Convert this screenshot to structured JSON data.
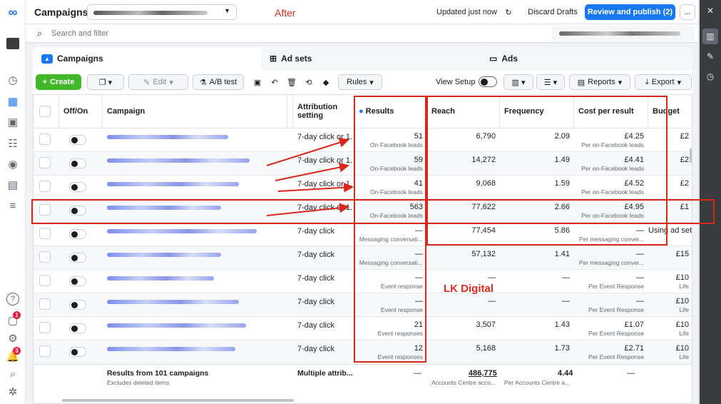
{
  "header": {
    "title": "Campaigns",
    "annotation": "After",
    "status": "Updated just now",
    "discard": "Discard Drafts",
    "review": "Review and publish (2)",
    "more": "..."
  },
  "search": {
    "placeholder": "Search and filter"
  },
  "tabs": [
    {
      "label": "Campaigns"
    },
    {
      "label": "Ad sets"
    },
    {
      "label": "Ads"
    }
  ],
  "toolbar": {
    "create": "Create",
    "edit": "Edit",
    "abtest": "A/B test",
    "rules": "Rules",
    "view_setup": "View Setup",
    "reports": "Reports",
    "export": "Export"
  },
  "columns": {
    "onoff": "Off/On",
    "campaign": "Campaign",
    "attribution": "Attribution setting",
    "results": "Results",
    "reach": "Reach",
    "frequency": "Frequency",
    "cpr": "Cost per result",
    "budget": "Budget"
  },
  "rows": [
    {
      "attr": "7-day click or 1...",
      "results": "51",
      "results_sub": "On-Facebook leads",
      "reach": "6,790",
      "freq": "2.09",
      "cpr": "£4.25",
      "cpr_sub": "Per on-Facebook leads",
      "budget": "£2",
      "budget_sub": ""
    },
    {
      "attr": "7-day click or 1...",
      "results": "59",
      "results_sub": "On-Facebook leads",
      "reach": "14,272",
      "freq": "1.49",
      "cpr": "£4.41",
      "cpr_sub": "Per on-Facebook leads",
      "budget": "£2",
      "budget_sub": ""
    },
    {
      "attr": "7-day click or 1...",
      "results": "41",
      "results_sub": "On-Facebook leads",
      "reach": "9,068",
      "freq": "1.59",
      "cpr": "£4.52",
      "cpr_sub": "Per on-Facebook leads",
      "budget": "£2",
      "budget_sub": ""
    },
    {
      "attr": "7-day click or 1...",
      "results": "563",
      "results_sub": "On-Facebook leads",
      "reach": "77,622",
      "freq": "2.66",
      "cpr": "£4.95",
      "cpr_sub": "Per on-Facebook leads",
      "budget": "£1",
      "budget_sub": ""
    },
    {
      "attr": "7-day click",
      "results": "—",
      "results_sub": "Messaging conversati...",
      "reach": "77,454",
      "freq": "5.86",
      "cpr": "—",
      "cpr_sub": "Per messaging conver...",
      "budget": "Using ad set bu",
      "budget_sub": ""
    },
    {
      "attr": "7-day click",
      "results": "—",
      "results_sub": "Messaging conversati...",
      "reach": "57,132",
      "freq": "1.41",
      "cpr": "—",
      "cpr_sub": "Per messaging conver...",
      "budget": "£15",
      "budget_sub": ""
    },
    {
      "attr": "7-day click",
      "results": "—",
      "results_sub": "Event response",
      "reach": "—",
      "freq": "—",
      "cpr": "—",
      "cpr_sub": "Per Event Response",
      "budget": "£10",
      "budget_sub": "Life"
    },
    {
      "attr": "7-day click",
      "results": "—",
      "results_sub": "Event response",
      "reach": "—",
      "freq": "—",
      "cpr": "—",
      "cpr_sub": "Per Event Response",
      "budget": "£10",
      "budget_sub": "Life"
    },
    {
      "attr": "7-day click",
      "results": "21",
      "results_sub": "Event responses",
      "reach": "3,507",
      "freq": "1.43",
      "cpr": "£1.07",
      "cpr_sub": "Per Event Response",
      "budget": "£10",
      "budget_sub": "Life"
    },
    {
      "attr": "7-day click",
      "results": "12",
      "results_sub": "Event responses",
      "reach": "5,168",
      "freq": "1.73",
      "cpr": "£2.71",
      "cpr_sub": "Per Event Response",
      "budget": "£10",
      "budget_sub": "Life"
    }
  ],
  "footer": {
    "title": "Results from 101 campaigns",
    "sub": "Excludes deleted items",
    "attr": "Multiple attrib...",
    "results": "—",
    "reach": "486,775",
    "reach_sub": "Accounts Centre acco...",
    "freq": "4.44",
    "freq_sub": "Per Accounts Centre a...",
    "cpr": "—"
  },
  "watermark": "LK Digital",
  "colors": {
    "accent": "#1877f2",
    "create": "#42b72a",
    "annotation": "#d9271c"
  }
}
